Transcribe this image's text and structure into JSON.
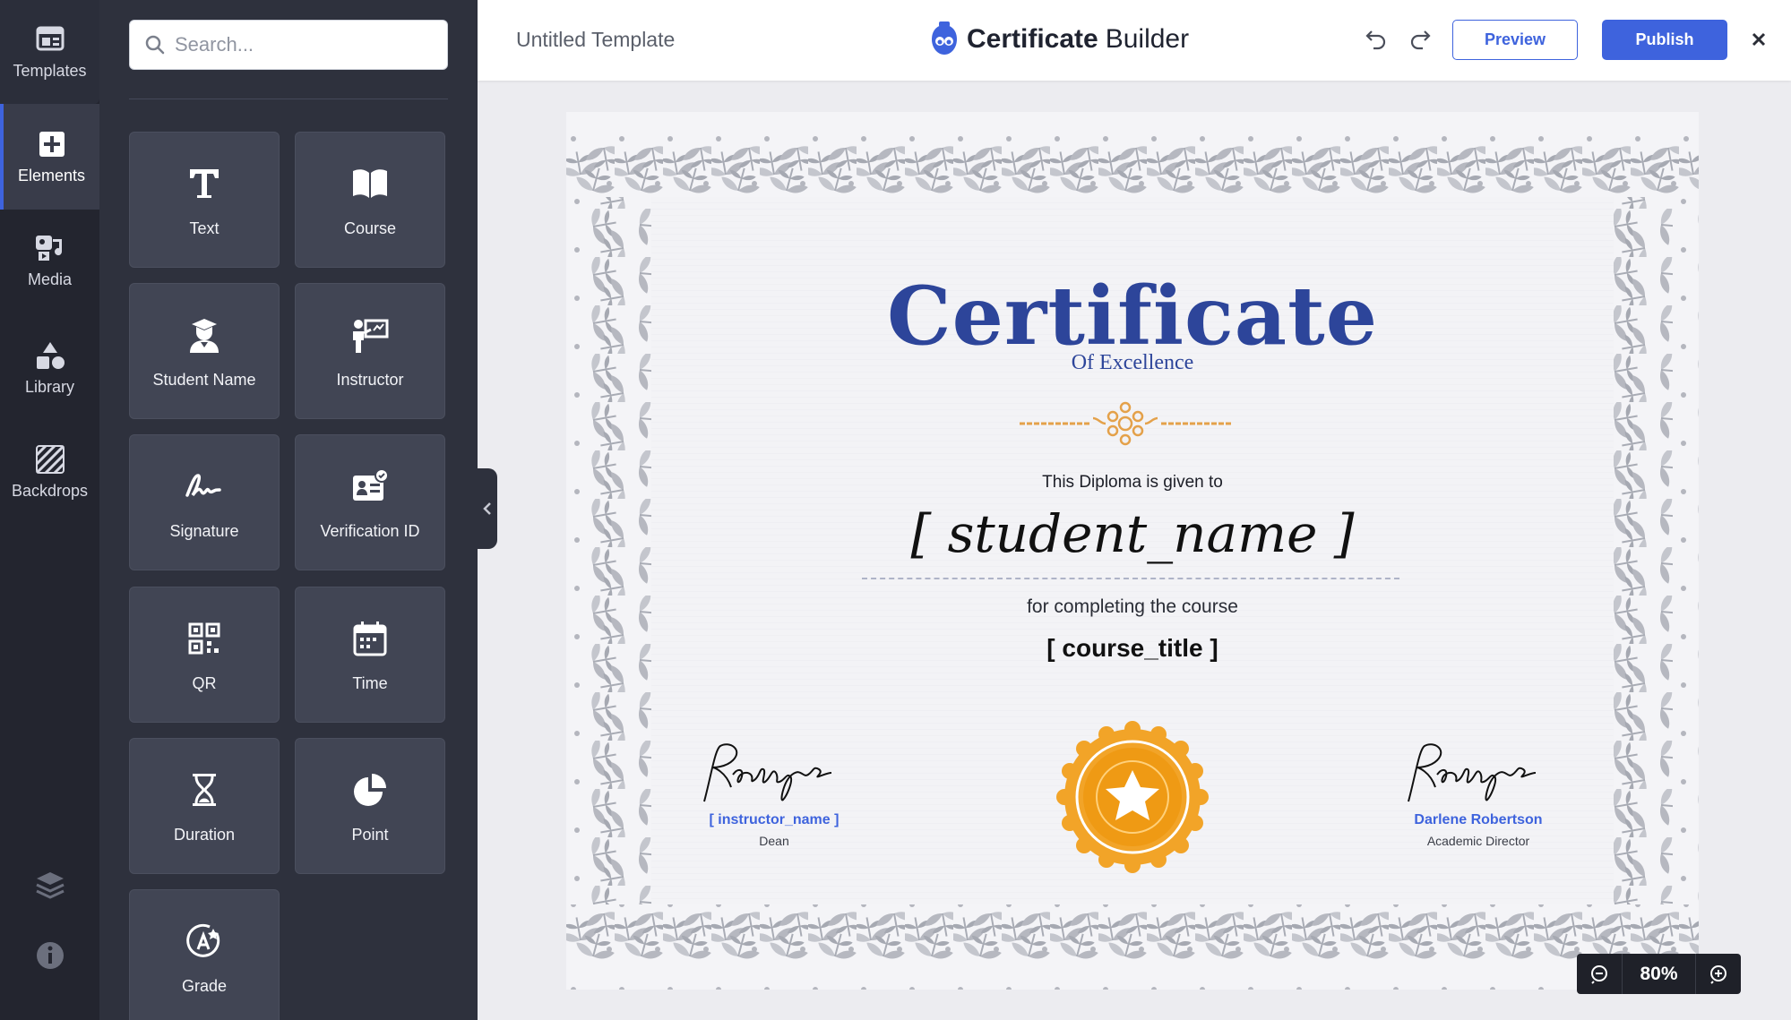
{
  "rail": {
    "items": [
      {
        "label": "Templates",
        "icon": "templates-icon"
      },
      {
        "label": "Elements",
        "icon": "plus-square-icon"
      },
      {
        "label": "Media",
        "icon": "media-icon"
      },
      {
        "label": "Library",
        "icon": "shapes-icon"
      },
      {
        "label": "Backdrops",
        "icon": "backdrops-icon"
      }
    ],
    "active": "Elements"
  },
  "search": {
    "placeholder": "Search..."
  },
  "elements": {
    "tiles": [
      {
        "label": "Text",
        "icon": "text-icon"
      },
      {
        "label": "Course",
        "icon": "book-icon"
      },
      {
        "label": "Student Name",
        "icon": "student-icon"
      },
      {
        "label": "Instructor",
        "icon": "instructor-icon"
      },
      {
        "label": "Signature",
        "icon": "signature-icon"
      },
      {
        "label": "Verification ID",
        "icon": "verification-id-icon"
      },
      {
        "label": "QR",
        "icon": "qr-icon"
      },
      {
        "label": "Time",
        "icon": "calendar-icon"
      },
      {
        "label": "Duration",
        "icon": "hourglass-icon"
      },
      {
        "label": "Point",
        "icon": "pie-icon"
      },
      {
        "label": "Grade",
        "icon": "grade-icon"
      }
    ]
  },
  "topbar": {
    "template_name": "Untitled Template",
    "brand_bold": "Certificate",
    "brand_light": "Builder",
    "preview_label": "Preview",
    "publish_label": "Publish"
  },
  "certificate": {
    "title": "Certificate",
    "subtitle": "Of Excellence",
    "given_to": "This Diploma is given to",
    "student": "[ student_name ]",
    "for_text": "for completing the course",
    "course": "[ course_title ]",
    "left_signer": {
      "name": "[ instructor_name ]",
      "role": "Dean"
    },
    "right_signer": {
      "name": "Darlene Robertson",
      "role": "Academic Director"
    }
  },
  "zoom": {
    "value": "80%"
  },
  "colors": {
    "accent": "#3e63dd",
    "navy": "#2d459a",
    "medal": "#f0a020"
  }
}
